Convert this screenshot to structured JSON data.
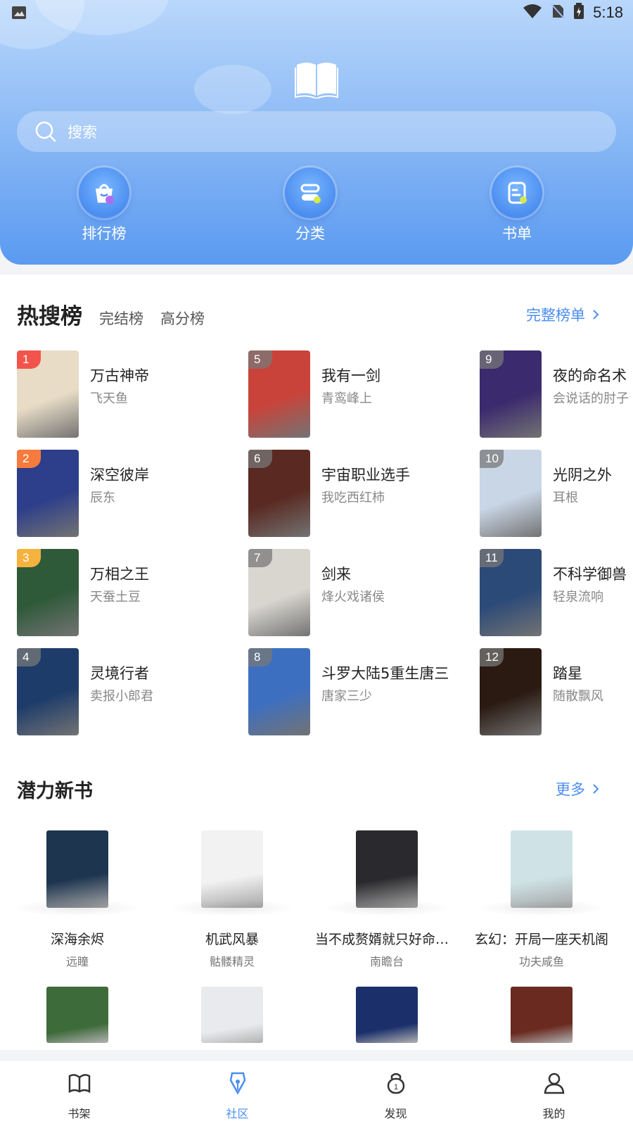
{
  "status_bar": {
    "time": "5:18"
  },
  "search": {
    "placeholder": "搜索"
  },
  "entries": [
    {
      "label": "排行榜",
      "icon": "ranking-bag-icon"
    },
    {
      "label": "分类",
      "icon": "category-icon"
    },
    {
      "label": "书单",
      "icon": "booklist-icon"
    }
  ],
  "hot_section": {
    "tabs": [
      "热搜榜",
      "完结榜",
      "高分榜"
    ],
    "full_link": "完整榜单",
    "books": [
      {
        "rank": "1",
        "title": "万古神帝",
        "author": "飞天鱼",
        "cover": "#e8dcc6"
      },
      {
        "rank": "2",
        "title": "深空彼岸",
        "author": "辰东",
        "cover": "#2d3e8a"
      },
      {
        "rank": "3",
        "title": "万相之王",
        "author": "天蚕土豆",
        "cover": "#2f5a3a"
      },
      {
        "rank": "4",
        "title": "灵境行者",
        "author": "卖报小郎君",
        "cover": "#1d3c6a"
      },
      {
        "rank": "5",
        "title": "我有一剑",
        "author": "青鸾峰上",
        "cover": "#c9433a"
      },
      {
        "rank": "6",
        "title": "宇宙职业选手",
        "author": "我吃西红柿",
        "cover": "#5a2a22"
      },
      {
        "rank": "7",
        "title": "剑来",
        "author": "烽火戏诸侯",
        "cover": "#d9d6d0"
      },
      {
        "rank": "8",
        "title": "斗罗大陆5重生唐三",
        "author": "唐家三少",
        "cover": "#3d6fc0"
      },
      {
        "rank": "9",
        "title": "夜的命名术",
        "author": "会说话的肘子",
        "cover": "#3b2a6e"
      },
      {
        "rank": "10",
        "title": "光阴之外",
        "author": "耳根",
        "cover": "#c9d6e6"
      },
      {
        "rank": "11",
        "title": "不科学御兽",
        "author": "轻泉流响",
        "cover": "#2c4a78"
      },
      {
        "rank": "12",
        "title": "踏星",
        "author": "随散飘风",
        "cover": "#2a1a12"
      }
    ]
  },
  "new_books": {
    "title": "潜力新书",
    "more": "更多",
    "row1": [
      {
        "title": "深海余烬",
        "author": "远瞳",
        "cover": "#1e3550"
      },
      {
        "title": "机武风暴",
        "author": "骷髅精灵",
        "cover": "#f2f2f2"
      },
      {
        "title": "当不成赘婿就只好命格成圣",
        "display": "当不成赘婿就只好命格...",
        "author": "南瞻台",
        "cover": "#2a2a2e"
      },
      {
        "title": "玄幻：开局一座天机阁",
        "author": "功夫咸鱼",
        "cover": "#cfe3e6"
      }
    ],
    "row2": [
      {
        "cover": "#3e6b3a"
      },
      {
        "cover": "#e8eaee"
      },
      {
        "cover": "#1b2f6b"
      },
      {
        "cover": "#6a2a20"
      }
    ]
  },
  "bottom_nav": [
    {
      "label": "书架",
      "icon": "bookshelf-icon",
      "active": false
    },
    {
      "label": "社区",
      "icon": "community-pen-icon",
      "active": true
    },
    {
      "label": "发现",
      "icon": "discover-icon",
      "active": false
    },
    {
      "label": "我的",
      "icon": "profile-icon",
      "active": false
    }
  ],
  "colors": {
    "accent": "#4b8ef0",
    "header_top": "#b9d7fb",
    "header_bottom": "#5a9af0"
  }
}
